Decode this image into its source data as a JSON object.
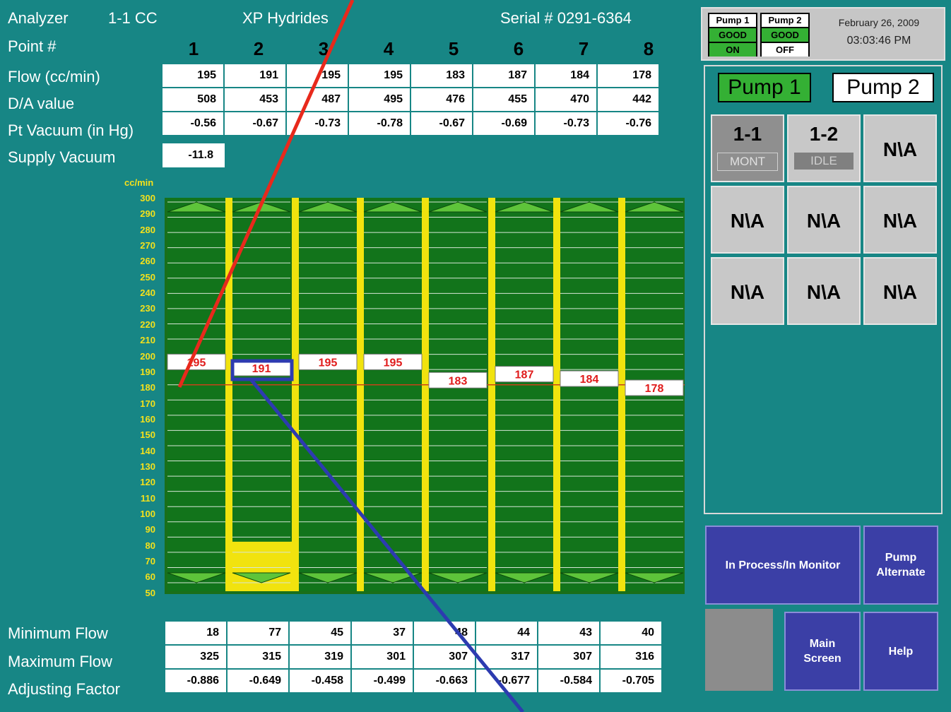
{
  "header": {
    "analyzer_label": "Analyzer",
    "analyzer_id": "1-1  CC",
    "product": "XP Hydrides",
    "serial": "Serial # 0291-6364",
    "point_label": "Point #"
  },
  "points": [
    "1",
    "2",
    "3",
    "4",
    "5",
    "6",
    "7",
    "8"
  ],
  "row_labels": {
    "flow": "Flow (cc/min)",
    "da": "D/A value",
    "pt_vacuum": "Pt Vacuum (in Hg)",
    "supply_vacuum": "Supply Vacuum",
    "min_flow": "Minimum Flow",
    "max_flow": "Maximum Flow",
    "adjusting_factor": "Adjusting Factor"
  },
  "table_top": {
    "flow": [
      "195",
      "191",
      "195",
      "195",
      "183",
      "187",
      "184",
      "178"
    ],
    "da": [
      "508",
      "453",
      "487",
      "495",
      "476",
      "455",
      "470",
      "442"
    ],
    "pt_vacuum": [
      "-0.56",
      "-0.67",
      "-0.73",
      "-0.78",
      "-0.67",
      "-0.69",
      "-0.73",
      "-0.76"
    ],
    "supply_vacuum": "-11.8"
  },
  "table_bottom": {
    "min_flow": [
      "18",
      "77",
      "45",
      "37",
      "48",
      "44",
      "43",
      "40"
    ],
    "max_flow": [
      "325",
      "315",
      "319",
      "301",
      "307",
      "317",
      "307",
      "316"
    ],
    "adjusting_factor": [
      "-0.886",
      "-0.649",
      "-0.458",
      "-0.499",
      "-0.663",
      "-0.677",
      "-0.584",
      "-0.705"
    ]
  },
  "chart_data": {
    "type": "bar",
    "unit_label": "cc/min",
    "ylim": [
      50,
      300
    ],
    "yticks": [
      "300",
      "290",
      "280",
      "270",
      "260",
      "250",
      "240",
      "230",
      "220",
      "210",
      "200",
      "190",
      "180",
      "170",
      "160",
      "150",
      "140",
      "130",
      "120",
      "110",
      "100",
      "90",
      "80",
      "70",
      "60",
      "50"
    ],
    "categories": [
      "1",
      "2",
      "3",
      "4",
      "5",
      "6",
      "7",
      "8"
    ],
    "values": [
      195,
      191,
      195,
      195,
      183,
      187,
      184,
      178
    ],
    "labels": [
      "195",
      "191",
      "195",
      "195",
      "183",
      "187",
      "184",
      "178"
    ],
    "min_flow": [
      18,
      77,
      45,
      37,
      48,
      44,
      43,
      40
    ],
    "max_flow": [
      325,
      315,
      319,
      301,
      307,
      317,
      307,
      316
    ],
    "setpoint": 180,
    "grid": true
  },
  "status": {
    "pump1_label": "Pump 1",
    "pump1_state": "GOOD",
    "pump1_power": "ON",
    "pump2_label": "Pump 2",
    "pump2_state": "GOOD",
    "pump2_power": "OFF",
    "date": "February 26, 2009",
    "time": "03:03:46 PM"
  },
  "pump_tabs": [
    "Pump 1",
    "Pump 2"
  ],
  "analyzers": [
    {
      "name": "1-1",
      "status": "MONT"
    },
    {
      "name": "1-2",
      "status": "IDLE"
    },
    {
      "name": "N\\A"
    },
    {
      "name": "N\\A"
    },
    {
      "name": "N\\A"
    },
    {
      "name": "N\\A"
    },
    {
      "name": "N\\A"
    },
    {
      "name": "N\\A"
    },
    {
      "name": "N\\A"
    }
  ],
  "buttons": {
    "in_process": "In Process/In Monitor",
    "pump_alternate_1": "Pump",
    "pump_alternate_2": "Alternate",
    "main_screen_1": "Main",
    "main_screen_2": "Screen",
    "help": "Help"
  },
  "colors": {
    "background": "#178685",
    "plot_green": "#12741b",
    "separator_yellow": "#f1e30e",
    "value_red": "#e01b1b",
    "pump_active_green": "#34b034",
    "button_blue": "#3b3fa6"
  }
}
